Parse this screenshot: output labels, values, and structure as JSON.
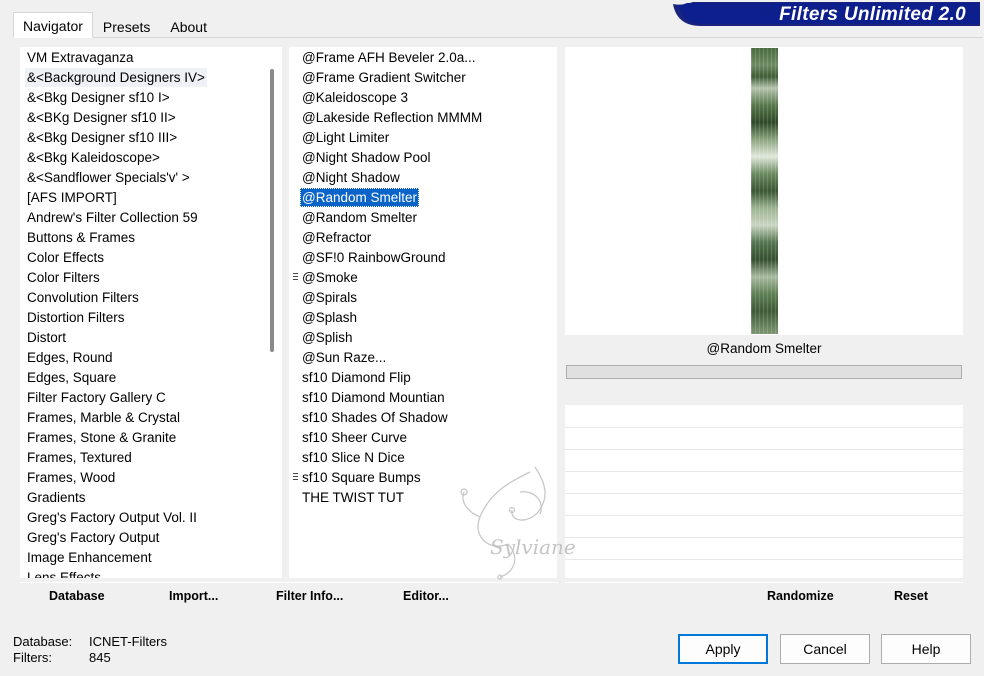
{
  "banner": {
    "title": "Filters Unlimited 2.0"
  },
  "tabs": [
    {
      "label": "Navigator",
      "active": true
    },
    {
      "label": "Presets",
      "active": false
    },
    {
      "label": "About",
      "active": false
    }
  ],
  "categories": [
    "VM Extravaganza",
    "&<Background Designers IV>",
    "&<Bkg Designer sf10 I>",
    "&<BKg Designer sf10 II>",
    "&<Bkg Designer sf10 III>",
    "&<Bkg Kaleidoscope>",
    "&<Sandflower Specials'v' >",
    "[AFS IMPORT]",
    "Andrew's Filter Collection 59",
    "Buttons & Frames",
    "Color Effects",
    "Color Filters",
    "Convolution Filters",
    "Distortion Filters",
    "Distort",
    "Edges, Round",
    "Edges, Square",
    "Filter Factory Gallery C",
    "Frames, Marble & Crystal",
    "Frames, Stone & Granite",
    "Frames, Textured",
    "Frames, Wood",
    "Gradients",
    "Greg's Factory Output Vol. II",
    "Greg's Factory Output",
    "Image Enhancement",
    "Lens Effects"
  ],
  "selected_category": "&<Background Designers IV>",
  "filters": [
    "@Frame AFH Beveler 2.0a...",
    "@Frame Gradient Switcher",
    "@Kaleidoscope 3",
    "@Lakeside Reflection MMMM",
    "@Light Limiter",
    "@Night Shadow Pool",
    "@Night Shadow",
    "@Random Smelter",
    "@Random Smelter",
    "@Refractor",
    "@SF!0 RainbowGround",
    "@Smoke",
    "@Spirals",
    "@Splash",
    "@Splish",
    "@Sun Raze...",
    "sf10 Diamond Flip",
    "sf10 Diamond Mountian",
    "sf10 Shades Of Shadow",
    "sf10 Sheer Curve",
    "sf10 Slice N Dice",
    "sf10 Square Bumps",
    "THE TWIST TUT"
  ],
  "selected_filter_index": 7,
  "marked_filter_indices": [
    11,
    21
  ],
  "preview": {
    "filter_name": "@Random Smelter"
  },
  "left_buttons": {
    "database": "Database",
    "import": "Import...",
    "filter_info": "Filter Info...",
    "editor": "Editor..."
  },
  "right_buttons": {
    "randomize": "Randomize",
    "reset": "Reset"
  },
  "status": {
    "database_label": "Database:",
    "database_value": "ICNET-Filters",
    "filters_label": "Filters:",
    "filters_value": "845"
  },
  "dialog_buttons": {
    "apply": "Apply",
    "cancel": "Cancel",
    "help": "Help"
  },
  "watermark": {
    "text": "Sylviane"
  }
}
